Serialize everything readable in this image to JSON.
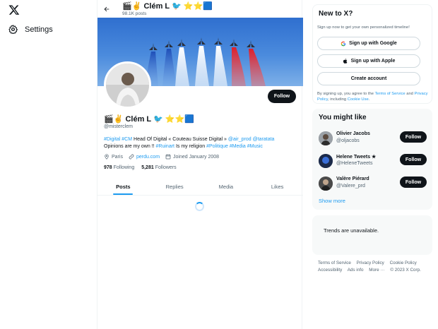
{
  "left_nav": {
    "logo": "x-logo",
    "settings_label": "Settings"
  },
  "topbar": {
    "name": "Clém L",
    "posts": "98.1K posts"
  },
  "profile": {
    "emoji_prefix": "🎬✌️",
    "name": "Clém L",
    "emoji_suffix": "⭐⭐🟦",
    "handle": "@misterclem",
    "follow_label": "Follow",
    "bio_line1_links_a": "#Digital #CM",
    "bio_line1_text": " Head Of Digital « Couteau Suisse Digital » ",
    "bio_line1_links_b": "@air_prod @taratata",
    "bio_line2_text_a": "Opinions are my own !! ",
    "bio_line2_link_a": "#Ruinart",
    "bio_line2_text_b": " Is my religion ",
    "bio_line2_links_b": "#Politique #Media #Music",
    "location": "Paris",
    "website": "perdu.com",
    "joined": "Joined January 2008",
    "following_count": "978",
    "following_label": "Following",
    "followers_count": "5,281",
    "followers_label": "Followers"
  },
  "tabs": [
    {
      "label": "Posts",
      "active": true
    },
    {
      "label": "Replies",
      "active": false
    },
    {
      "label": "Media",
      "active": false
    },
    {
      "label": "Likes",
      "active": false
    }
  ],
  "new_to_x": {
    "title": "New to X?",
    "subtitle": "Sign up now to get your own personalized timeline!",
    "google_label": "Sign up with Google",
    "apple_label": "Sign up with Apple",
    "create_label": "Create account",
    "terms_prefix": "By signing up, you agree to the ",
    "terms_link": "Terms of Service",
    "terms_and": " and ",
    "privacy_link": "Privacy Policy",
    "terms_including": ", including ",
    "cookie_link": "Cookie Use",
    "terms_end": "."
  },
  "who_to_follow": {
    "title": "You might like",
    "users": [
      {
        "name": "Olivier Jacobs",
        "handle": "@oljacobs",
        "follow": "Follow"
      },
      {
        "name": "Helene Tweets ★",
        "handle": "@HeleneTweets",
        "follow": "Follow"
      },
      {
        "name": "Valère Piérard",
        "handle": "@Valere_prd",
        "follow": "Follow"
      }
    ],
    "show_more": "Show more"
  },
  "trends": {
    "text": "Trends are unavailable."
  },
  "footer": {
    "links": [
      "Terms of Service",
      "Privacy Policy",
      "Cookie Policy",
      "Accessibility",
      "Ads info",
      "More ···",
      "© 2023 X Corp."
    ]
  },
  "colors": {
    "accent": "#1d9bf0",
    "text": "#0f1419",
    "muted": "#536471"
  }
}
